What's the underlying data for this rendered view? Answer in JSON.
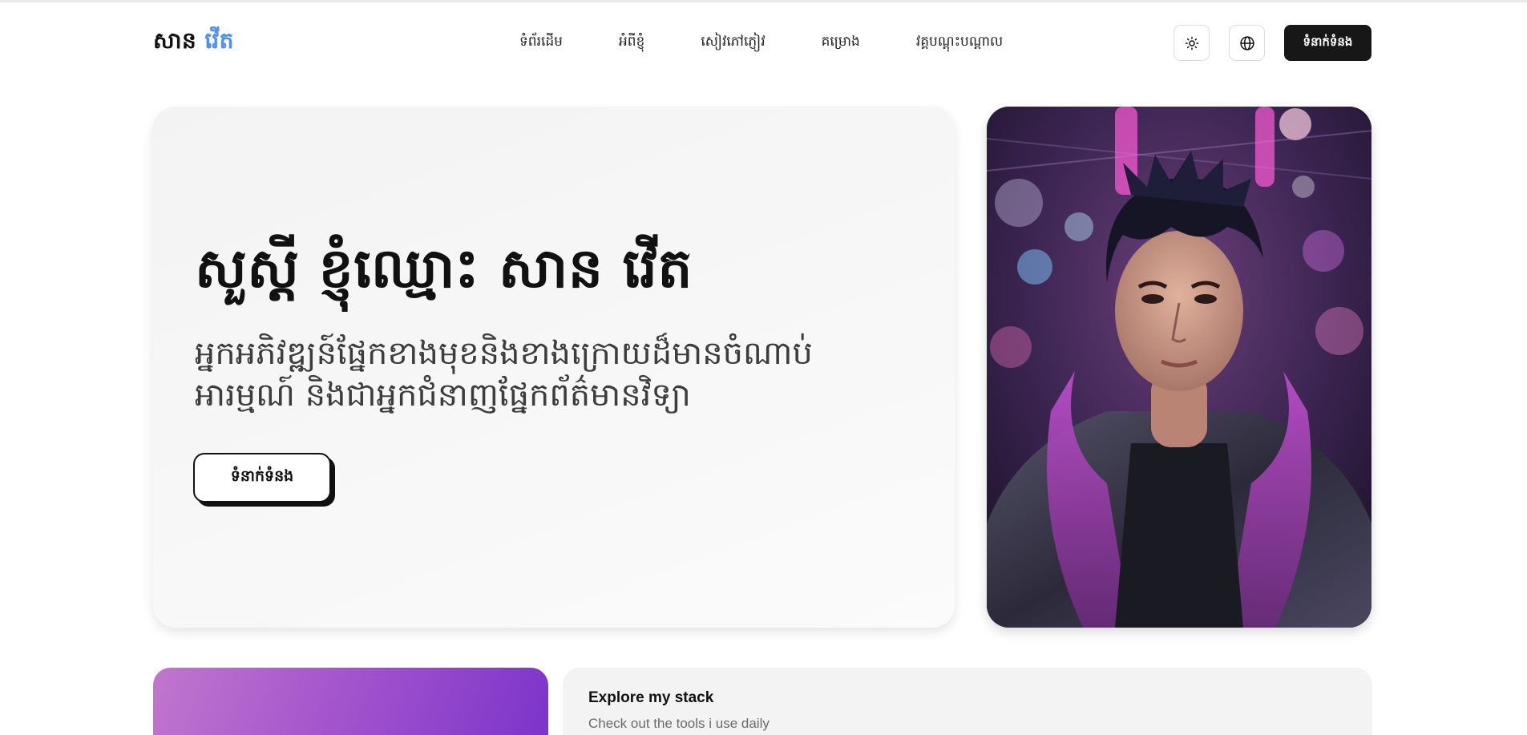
{
  "header": {
    "logo_first": "សាន",
    "logo_last": "វើត",
    "nav_items": [
      {
        "label": "ទំព័រដើម"
      },
      {
        "label": "អំពីខ្ញុំ"
      },
      {
        "label": "សៀវភៅភ្ញៀវ"
      },
      {
        "label": "គម្រោង"
      },
      {
        "label": "វគ្គបណ្តុះបណ្តាល"
      }
    ],
    "theme_icon": "sun-icon",
    "language_icon": "globe-icon",
    "contact_label": "ទំនាក់ទំនង"
  },
  "hero": {
    "title": "សួស្ដី ខ្ញុំឈ្មោះ សាន វើត",
    "subtitle": "អ្នកអភិវឌ្ឍន៍ផ្នែកខាងមុខនិងខាងក្រោយដ៏មានចំណាប់អារម្មណ៍ និងជាអ្នកជំនាញផ្នែកព័ត៌មានវិទ្យា",
    "cta_label": "ទំនាក់ទំនង",
    "portrait": "portrait-photo"
  },
  "stack_card": {
    "title": "Explore my stack",
    "subtitle": "Check out the tools i use daily"
  },
  "colors": {
    "accent": "#4f8ef7",
    "dark": "#171717",
    "gradient_start": "#c176cd",
    "gradient_end": "#7a33c9"
  }
}
